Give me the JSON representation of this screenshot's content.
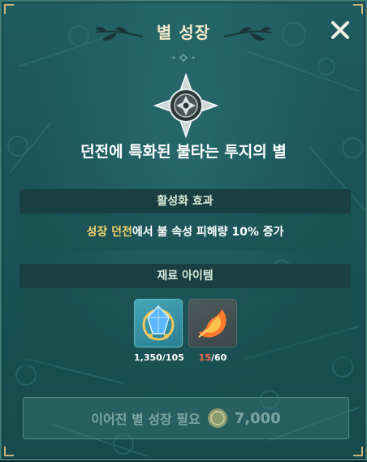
{
  "header": {
    "title": "별 성장"
  },
  "star": {
    "name": "던전에 특화된 불타는 투지의 별"
  },
  "effect": {
    "heading": "활성화 효과",
    "highlight": "성장 던전",
    "text": "에서 불 속성 피해량 10% 증가"
  },
  "materials": {
    "heading": "재료 아이템",
    "items": [
      {
        "icon": "blue-crystal-icon",
        "count_text": "1,350/105"
      },
      {
        "icon": "fire-feather-icon",
        "have": "15",
        "need": "/60"
      }
    ]
  },
  "action": {
    "label": "이어진 별 성장 필요",
    "cost": "7,000",
    "currency_icon": "coin-icon"
  },
  "colors": {
    "accent": "#f3d36a",
    "shortage": "#ff6a4b",
    "panel": "#1a5356"
  }
}
